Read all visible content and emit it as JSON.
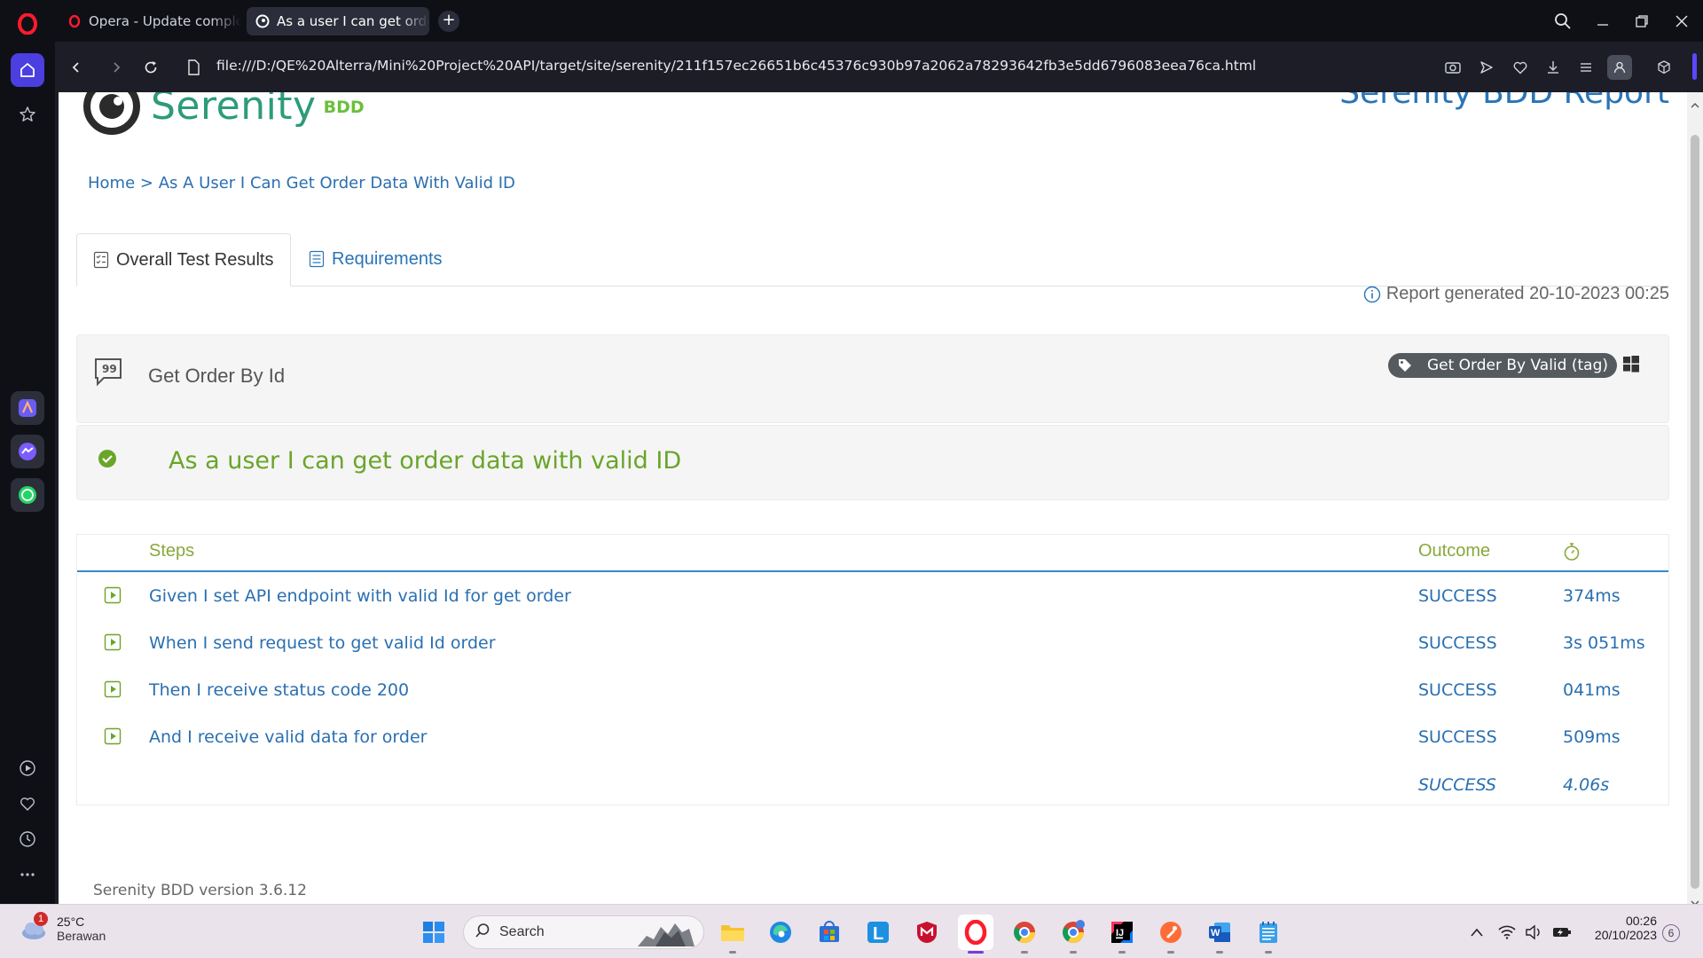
{
  "browser": {
    "tabs": [
      {
        "label": "Opera - Update complete",
        "active": false
      },
      {
        "label": "As a user I can get order data with valid ID",
        "active": true
      }
    ],
    "address": "file:///D:/QE%20Alterra/Mini%20Project%20API/target/site/serenity/211f157ec26651b6c45376c930b97a2062a78293642fb3e5dd6796083eea76ca.html"
  },
  "page": {
    "logo_text": "Serenity",
    "logo_suffix": "BDD",
    "report_title": "Serenity BDD Report",
    "breadcrumb": {
      "home": "Home",
      "separator": ">",
      "current": "As A User I Can Get Order Data With Valid ID"
    },
    "tabs": {
      "overall": "Overall Test Results",
      "requirements": "Requirements"
    },
    "report_generated": "Report generated 20-10-2023 00:25",
    "feature": {
      "title": "Get Order By Id",
      "tag": "Get Order By Valid (tag)"
    },
    "scenario": {
      "title": "As a user I can get order data with valid ID",
      "status_color": "#6aa52a"
    },
    "steps_table": {
      "headers": {
        "steps": "Steps",
        "outcome": "Outcome"
      },
      "rows": [
        {
          "step": "Given I set API endpoint with valid Id for get order",
          "outcome": "SUCCESS",
          "duration": "374ms"
        },
        {
          "step": "When I send request to get valid Id order",
          "outcome": "SUCCESS",
          "duration": "3s 051ms"
        },
        {
          "step": "Then I receive status code 200",
          "outcome": "SUCCESS",
          "duration": "041ms"
        },
        {
          "step": "And I receive valid data for order",
          "outcome": "SUCCESS",
          "duration": "509ms"
        }
      ],
      "total": {
        "outcome": "SUCCESS",
        "duration": "4.06s"
      }
    },
    "version": "Serenity BDD version 3.6.12"
  },
  "taskbar": {
    "weather": {
      "temp": "25°C",
      "desc": "Berawan",
      "badge": "1"
    },
    "search_label": "Search",
    "clock_time": "00:26",
    "clock_date": "20/10/2023",
    "notification_count": "6"
  },
  "colors": {
    "accent_blue": "#2a74b7",
    "success_green": "#6aa52a",
    "serenity_teal": "#2d9b7a"
  }
}
